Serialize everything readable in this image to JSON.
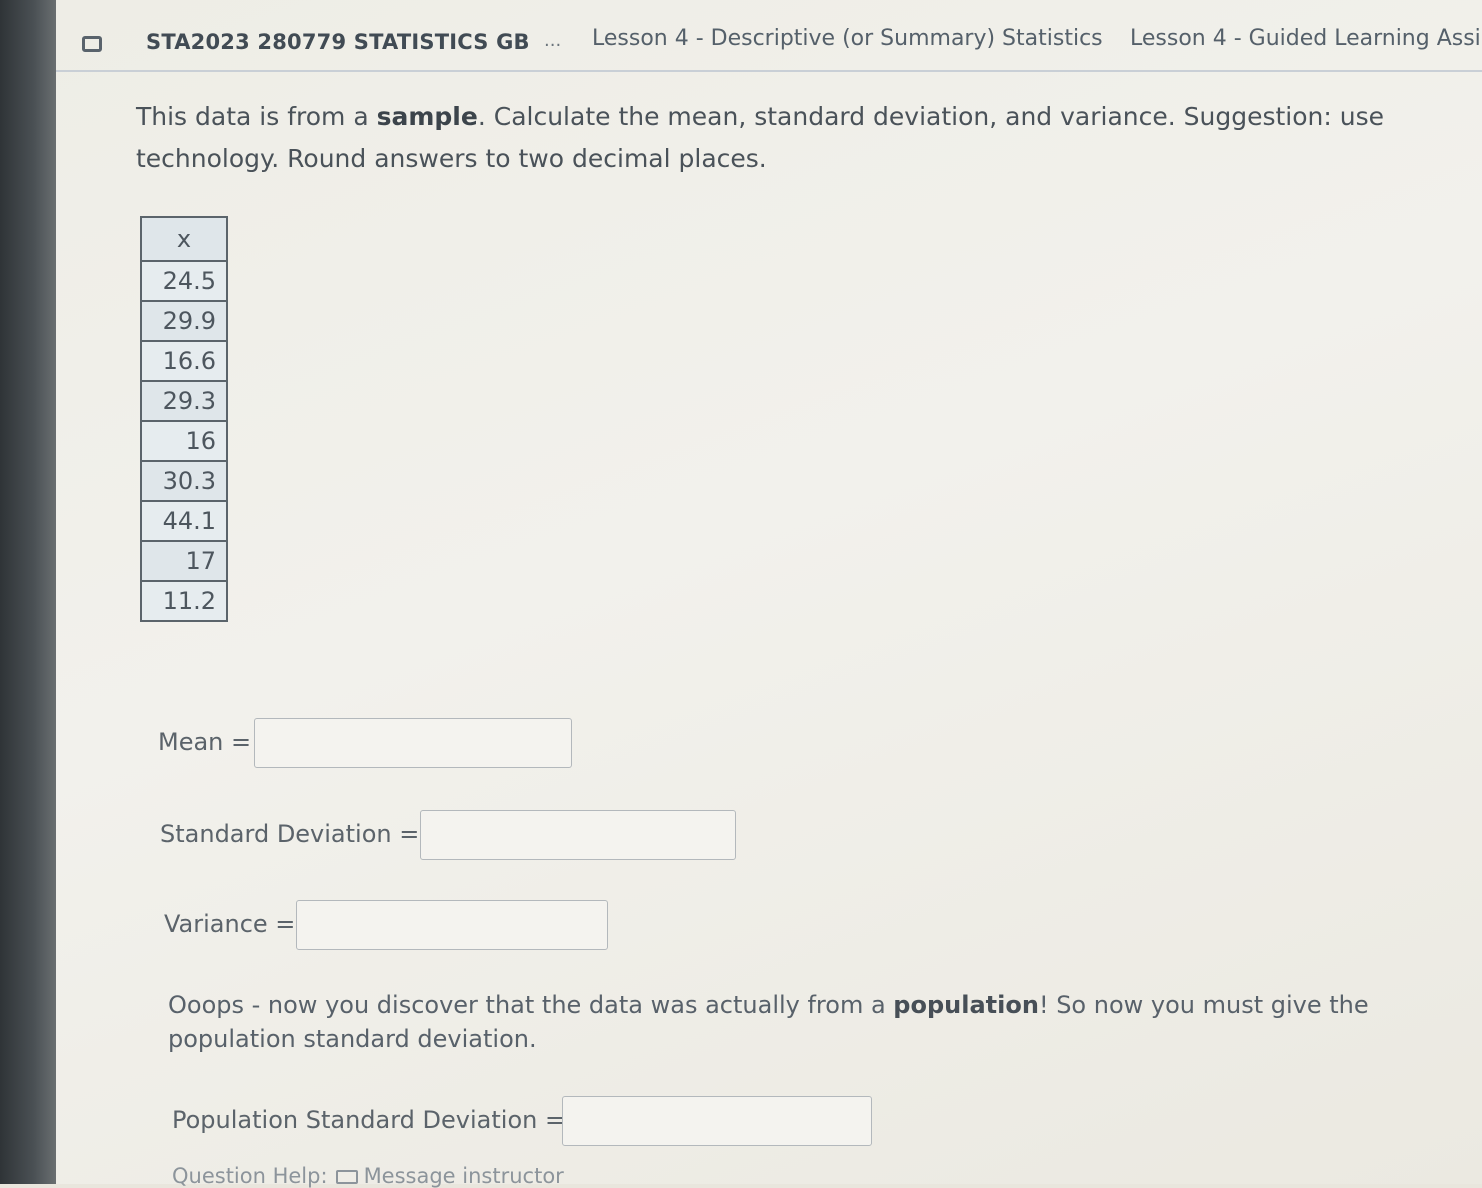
{
  "topbar": {
    "course": "STA2023 280779 STATISTICS GB",
    "ellipsis": "...",
    "crumb1": "Lesson 4 - Descriptive (or Summary) Statistics",
    "crumb2": "Lesson 4 - Guided Learning Assi"
  },
  "question": {
    "part1": "This data is from a ",
    "bold": "sample",
    "part2": ". Calculate the mean, standard deviation, and variance. Suggestion: use technology. Round answers to two decimal places."
  },
  "table": {
    "header": "x",
    "values": [
      "24.5",
      "29.9",
      "16.6",
      "29.3",
      "16",
      "30.3",
      "44.1",
      "17",
      "11.2"
    ]
  },
  "fields": {
    "mean_label": "Mean =",
    "sd_label": "Standard Deviation =",
    "variance_label": "Variance =",
    "pop_sd_label": "Population Standard Deviation ="
  },
  "followup": {
    "part1": "Ooops - now you discover that the data was actually from a ",
    "bold": "population",
    "part2": "! So now you must give the population standard deviation."
  },
  "help": {
    "label": "Question Help:",
    "message": "Message instructor"
  }
}
